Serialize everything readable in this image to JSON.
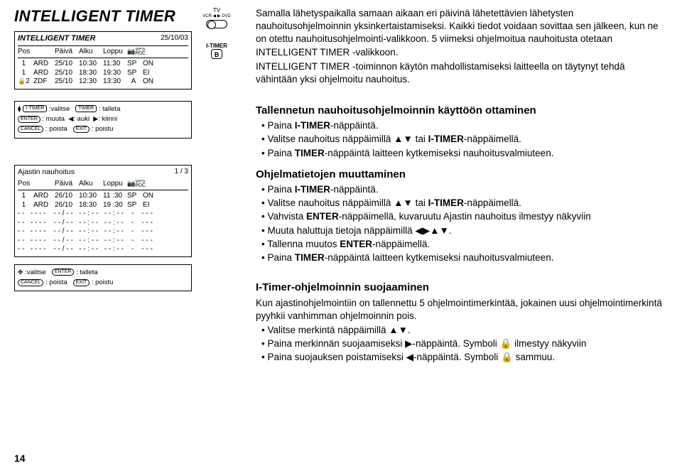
{
  "page": {
    "title": "INTELLIGENT TIMER",
    "number": "14"
  },
  "icons": {
    "tv": "TV",
    "vcr_dvd": "VCR ◀ ▶ DVD",
    "itimer_label": "I-TIMER",
    "btn_b": "B"
  },
  "osd1": {
    "title": "INTELLIGENT TIMER",
    "date": "25/10/03",
    "h_pos": "Pos",
    "h_paiva": "Päivä",
    "h_alku": "Alku",
    "h_loppu": "Loppu",
    "h_vps": "VPS\nPDC",
    "r1": {
      "pos": "1",
      "ch": "ARD",
      "d": "25/10",
      "t1": "10:30",
      "t2": "11:30",
      "sp": "SP",
      "on": "ON"
    },
    "r2": {
      "pos": "1",
      "ch": "ARD",
      "d": "25/10",
      "t1": "18:30",
      "t2": "19:30",
      "sp": "SP",
      "on": "EI"
    },
    "r3": {
      "lock": "🔒",
      "pos": "2",
      "ch": "ZDF",
      "d": "25/10",
      "t1": "12:30",
      "t2": "13:30",
      "sp": "A",
      "on": "ON"
    }
  },
  "legend1": {
    "l1a": ":valitse",
    "l1b": ": talleta",
    "l2a": ": muuta",
    "l2b": ": auki",
    "l2c": ": kiinni",
    "l3a": ": poista",
    "l3b": ": poistu",
    "k_itimer": "I-TIMER",
    "k_timer": "TIMER",
    "k_enter": "ENTER",
    "k_cancel": "CANCEL",
    "k_exit": "EXIT"
  },
  "osd2": {
    "title": "Ajastin nauhoitus",
    "page": "1 / 3",
    "h_pos": "Pos",
    "h_paiva": "Päivä",
    "h_alku": "Alku",
    "h_loppu": "Loppu",
    "h_vps": "VPS\nPDC",
    "r1": {
      "pos": "1",
      "ch": "ARD",
      "d": "26/10",
      "t1": "10:30",
      "t2": "11 :30",
      "sp": "SP",
      "on": "ON"
    },
    "r2": {
      "pos": "1",
      "ch": "ARD",
      "d": "26/10",
      "t1": "18:30",
      "t2": "19 :30",
      "sp": "SP",
      "on": "EI"
    },
    "blank": "- -   - - - -    - - / - -   - - : - -   - - : - -    -    - - -"
  },
  "legend2": {
    "l1a": ":valitse",
    "l1b": ": talleta",
    "l2a": ": poista",
    "l2b": ": poistu",
    "k_enter": "ENTER",
    "k_cancel": "CANCEL",
    "k_exit": "EXIT"
  },
  "intro": {
    "p1": "Samalla lähetyspaikalla samaan aikaan eri päivinä lähetettävien lähetysten nauhoitusohjelmoinnin yksinkertaistamiseksi. Kaikki tiedot voidaan sovittaa sen jälkeen, kun ne on otettu nauhoitusohjelmointi-valikkoon. 5 viimeksi ohjelmoitua nauhoitusta otetaan INTELLIGENT TIMER -valikkoon.",
    "p2": "INTELLIGENT TIMER -toiminnon käytön mahdollistamiseksi laitteella on täytynyt tehdä vähintään yksi ohjelmoitu nauhoitus."
  },
  "sec1": {
    "h": "Tallennetun nauhoitusohjelmoinnin käyttöön ottaminen",
    "b1a": "Paina ",
    "b1b": "I-TIMER",
    "b1c": "-näppäintä.",
    "b2a": "Valitse nauhoitus näppäimillä ▲▼ tai ",
    "b2b": "I-TIMER",
    "b2c": "-näppäimellä.",
    "b3a": "Paina ",
    "b3b": "TIMER",
    "b3c": "-näppäintä laitteen kytkemiseksi nauhoitusvalmiuteen."
  },
  "sec2": {
    "h": "Ohjelmatietojen muuttaminen",
    "b1a": "Paina ",
    "b1b": "I-TIMER",
    "b1c": "-näppäintä.",
    "b2a": "Valitse nauhoitus näppäimillä ▲▼ tai ",
    "b2b": "I-TIMER",
    "b2c": "-näppäimellä.",
    "b3a": "Vahvista ",
    "b3b": "ENTER",
    "b3c": "-näppäimellä, kuvaruutu ",
    "b3d": "Ajastin nauhoitus",
    "b3e": " ilmestyy näkyviin",
    "b4": "Muuta haluttuja tietoja näppäimillä ◀▶▲▼.",
    "b5a": "Tallenna muutos ",
    "b5b": "ENTER",
    "b5c": "-näppäimellä.",
    "b6a": "Paina ",
    "b6b": "TIMER",
    "b6c": "-näppäintä laitteen kytkemiseksi nauhoitusvalmiuteen."
  },
  "sec3": {
    "h": "I-Timer-ohjelmoinnin suojaaminen",
    "p": "Kun ajastinohjelmointiin on tallennettu 5 ohjelmointimerkintää, jokainen uusi ohjelmointimerkintä pyyhkii vanhimman ohjelmoinnin pois.",
    "b1": "Valitse merkintä näppäimillä ▲▼.",
    "b2": "Paina merkinnän suojaamiseksi ▶-näppäintä. Symboli 🔒 ilmestyy näkyviin",
    "b3": "Paina suojauksen poistamiseksi ◀-näppäintä. Symboli 🔒 sammuu."
  }
}
